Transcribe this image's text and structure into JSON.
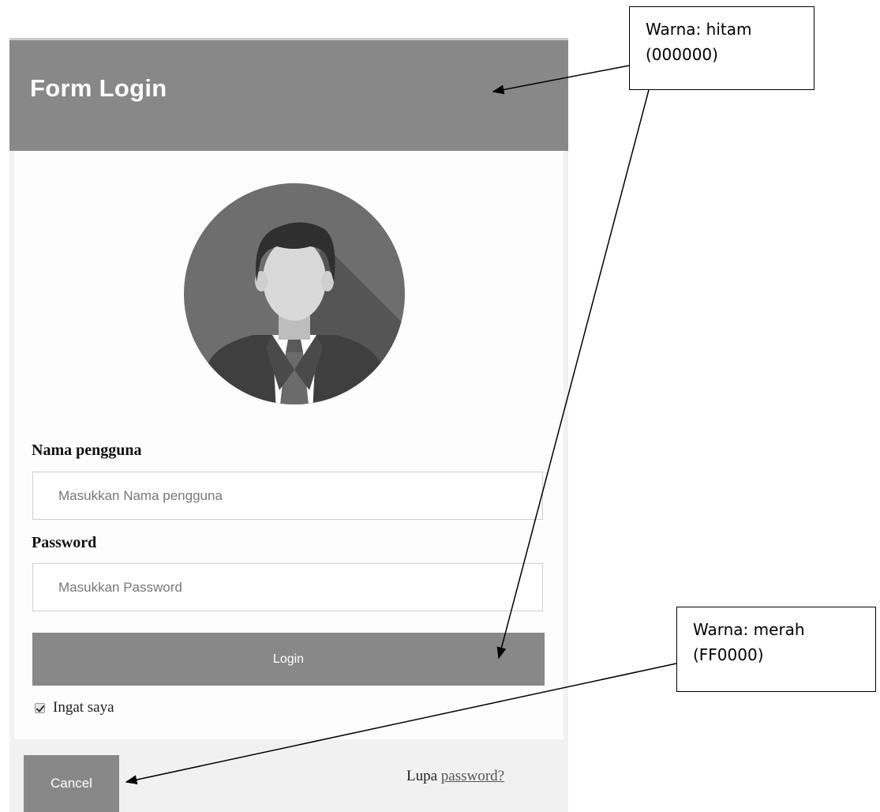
{
  "form": {
    "title": "Form Login",
    "username_label": "Nama pengguna",
    "username_placeholder": "Masukkan Nama pengguna",
    "password_label": "Password",
    "password_placeholder": "Masukkan Password",
    "login_label": "Login",
    "remember_label": "Ingat saya",
    "remember_checked": true,
    "cancel_label": "Cancel",
    "forgot_prefix": "Lupa ",
    "forgot_link": "password?"
  },
  "annotations": {
    "black_note": {
      "line1": "Warna: hitam",
      "line2": "(000000)"
    },
    "red_note": {
      "line1": "Warna: merah",
      "line2": "(FF0000)"
    }
  },
  "colors": {
    "header_bg": "#888888",
    "button_bg": "#888888",
    "page_bg": "#ffffff",
    "panel_bg": "#fdfdfd",
    "footer_bg": "#f1f1f1"
  }
}
